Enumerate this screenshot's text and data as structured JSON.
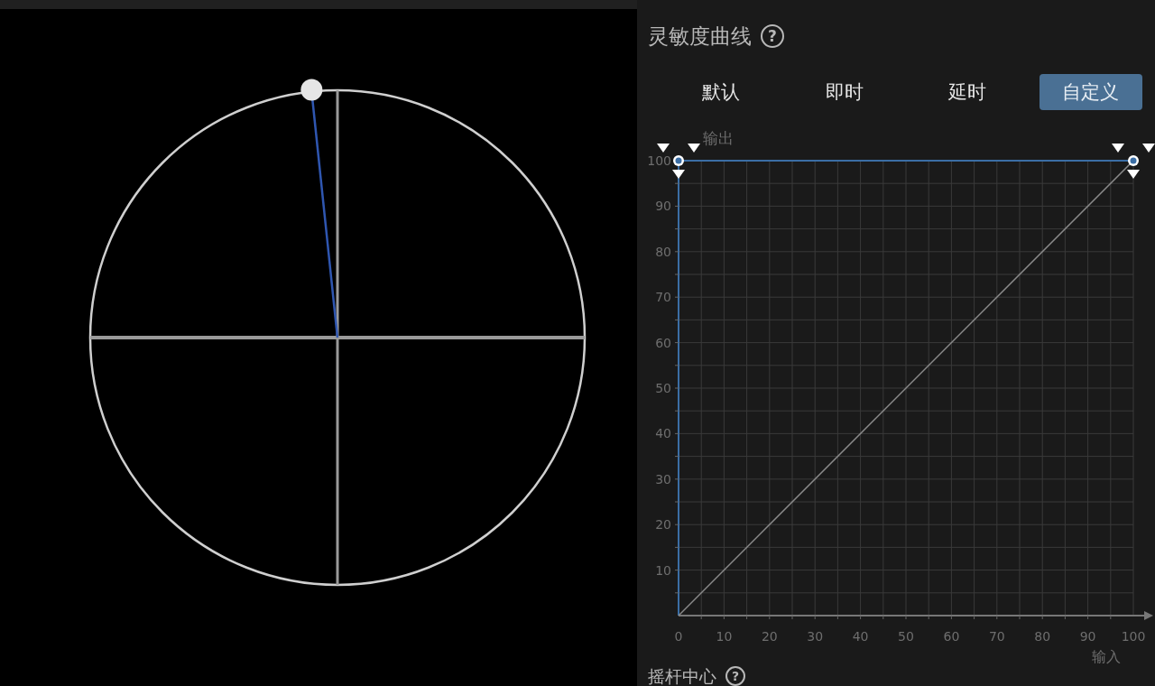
{
  "settings": {
    "title": "灵敏度曲线",
    "help": "?",
    "tabs": [
      {
        "label": "默认",
        "selected": false
      },
      {
        "label": "即时",
        "selected": false
      },
      {
        "label": "延时",
        "selected": false
      },
      {
        "label": "自定义",
        "selected": true
      }
    ],
    "chart_data": {
      "type": "line",
      "xlabel": "输入",
      "ylabel": "输出",
      "x": [
        0,
        100
      ],
      "series": [
        {
          "color": "#8a8a8a",
          "values": [
            0,
            100
          ]
        },
        {
          "color": "#3b6ea5",
          "marker": "o",
          "values": [
            100,
            100
          ]
        }
      ],
      "grid": true,
      "xlim": [
        0,
        100
      ],
      "ylim": [
        0,
        100
      ],
      "xticks": [
        0,
        10,
        20,
        30,
        40,
        50,
        60,
        70,
        80,
        90,
        100
      ],
      "yticks": [
        10,
        20,
        30,
        40,
        50,
        60,
        70,
        80,
        90,
        100
      ]
    },
    "next_title": "摇杆中心",
    "next_help": "?"
  }
}
